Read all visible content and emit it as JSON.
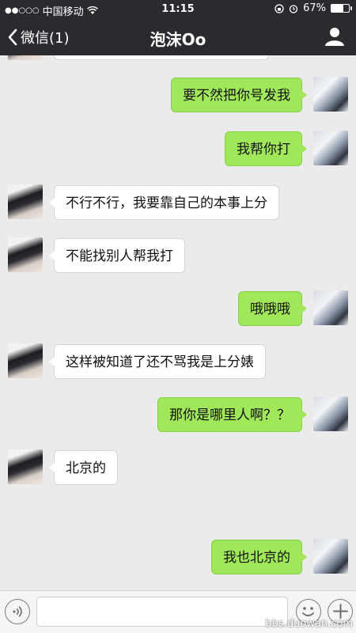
{
  "status_bar": {
    "carrier": "中国移动",
    "signal_dots": "●●○○○",
    "time": "11:15",
    "battery": "67%",
    "battery_level": 0.67
  },
  "nav": {
    "back_label": "微信(1)",
    "title": "泡沫Oo"
  },
  "messages": [
    {
      "sender": "me",
      "text": "要不然把你号发我"
    },
    {
      "sender": "me",
      "text": "我帮你打"
    },
    {
      "sender": "other",
      "text": "不行不行，我要靠自己的本事上分"
    },
    {
      "sender": "other",
      "text": "不能找别人帮我打"
    },
    {
      "sender": "me",
      "text": "哦哦哦"
    },
    {
      "sender": "other",
      "text": "这样被知道了还不骂我是上分婊"
    },
    {
      "sender": "me",
      "text": "那你是哪里人啊？？"
    },
    {
      "sender": "other",
      "text": "北京的"
    },
    {
      "sender": "me",
      "text": "我也北京的"
    }
  ],
  "input_bar": {
    "placeholder": "",
    "watermark": "bbs.duowan.com"
  }
}
